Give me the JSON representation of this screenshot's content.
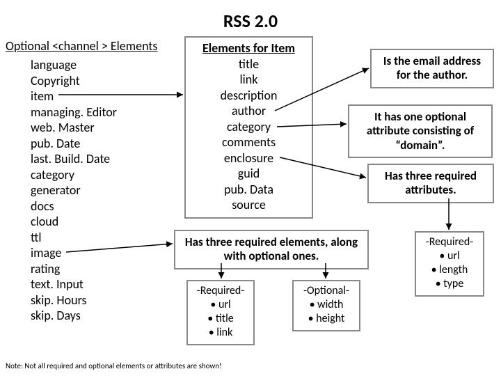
{
  "title": "RSS 2.0",
  "channel": {
    "header": "Optional <channel > Elements",
    "items": [
      "language",
      "Copyright",
      "item",
      "managing. Editor",
      "web. Master",
      "pub. Date",
      "last. Build. Date",
      "category",
      "generator",
      "docs",
      "cloud",
      "ttl",
      "image",
      "rating",
      "text. Input",
      "skip. Hours",
      "skip. Days"
    ]
  },
  "item_box": {
    "header": "Elements for Item",
    "rows": [
      "title",
      "link",
      "description",
      "author",
      "category",
      "comments",
      "enclosure",
      "guid",
      "pub. Data",
      "source"
    ]
  },
  "notes": {
    "author": "Is the email address for the author.",
    "category": "It has one optional attribute consisting of “domain”.",
    "enclosure": "Has three required attributes.",
    "image": "Has three required elements, along with optional ones."
  },
  "image_required": {
    "title": "-Required-",
    "items": [
      "• url",
      "• title",
      "• link"
    ]
  },
  "image_optional": {
    "title": "-Optional-",
    "items": [
      "• width",
      "• height"
    ]
  },
  "enclosure_required": {
    "title": "-Required-",
    "items": [
      "• url",
      "• length",
      "• type"
    ]
  },
  "footer": "Note: Not all required and optional elements or attributes are shown!"
}
